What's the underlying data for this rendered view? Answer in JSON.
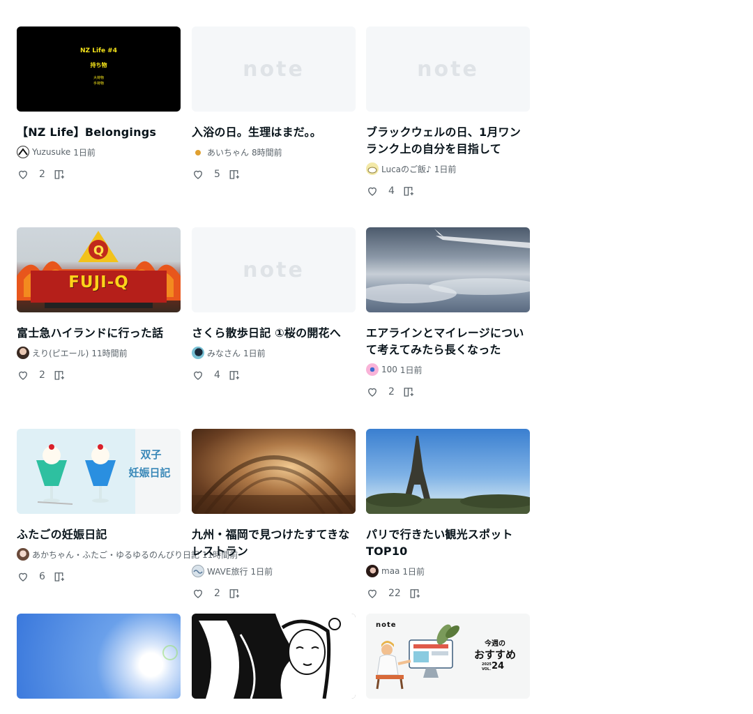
{
  "cards": [
    {
      "title": "【NZ Life】Belongings",
      "author": "Yuzusuke",
      "time": "1日前",
      "likes": "2",
      "thumb_text": [
        "NZ Life #4",
        "持ち物",
        "大荷物",
        "手荷物"
      ]
    },
    {
      "title": "入浴の日。生理はまだ。。",
      "author": "あいちゃん",
      "time": "8時間前",
      "likes": "5",
      "thumb_text": [
        "note"
      ]
    },
    {
      "title": "ブラックウェルの日、1月ワンランク上の自分を目指して",
      "author": "Lucaのご飯♪",
      "time": "1日前",
      "likes": "4",
      "thumb_text": [
        "note"
      ]
    },
    {
      "title": "富士急ハイランドに行った話",
      "author": "えり(ピエール)",
      "time": "11時間前",
      "likes": "2",
      "thumb_text": [
        "FUJI-Q",
        "Q"
      ]
    },
    {
      "title": "さくら散歩日記 ①桜の開花へ",
      "author": "みなさん",
      "time": "1日前",
      "likes": "4",
      "thumb_text": [
        "note"
      ]
    },
    {
      "title": "エアラインとマイレージについて考えてみたら長くなった",
      "author": "100",
      "time": "1日前",
      "likes": "2",
      "thumb_text": []
    },
    {
      "title": "ふたごの妊娠日記",
      "author": "あかちゃん・ふたご・ゆるゆるのんびり日記",
      "time": "11時間前",
      "likes": "6",
      "thumb_text": [
        "双子",
        "妊娠日記"
      ]
    },
    {
      "title": "九州・福岡で見つけたすてきなレストラン",
      "author": "WAVE旅行",
      "time": "1日前",
      "likes": "2",
      "thumb_text": []
    },
    {
      "title": "パリで行きたい観光スポットTOP10",
      "author": "maa",
      "time": "1日前",
      "likes": "22",
      "thumb_text": []
    },
    {
      "title": "",
      "author": "",
      "time": "",
      "likes": "",
      "thumb_text": []
    },
    {
      "title": "",
      "author": "",
      "time": "",
      "likes": "",
      "thumb_text": []
    },
    {
      "title": "",
      "author": "",
      "time": "",
      "likes": "",
      "thumb_text": [
        "note",
        "今週の",
        "おすすめ",
        "2025",
        "VOL.",
        "24"
      ]
    }
  ],
  "icons": {
    "like": "heart-icon",
    "add_to_magazine": "magazine-add-icon"
  },
  "colors": {
    "text": "#08131a",
    "muted": "#5a636a",
    "placeholder_bg": "#f5f7f9"
  }
}
